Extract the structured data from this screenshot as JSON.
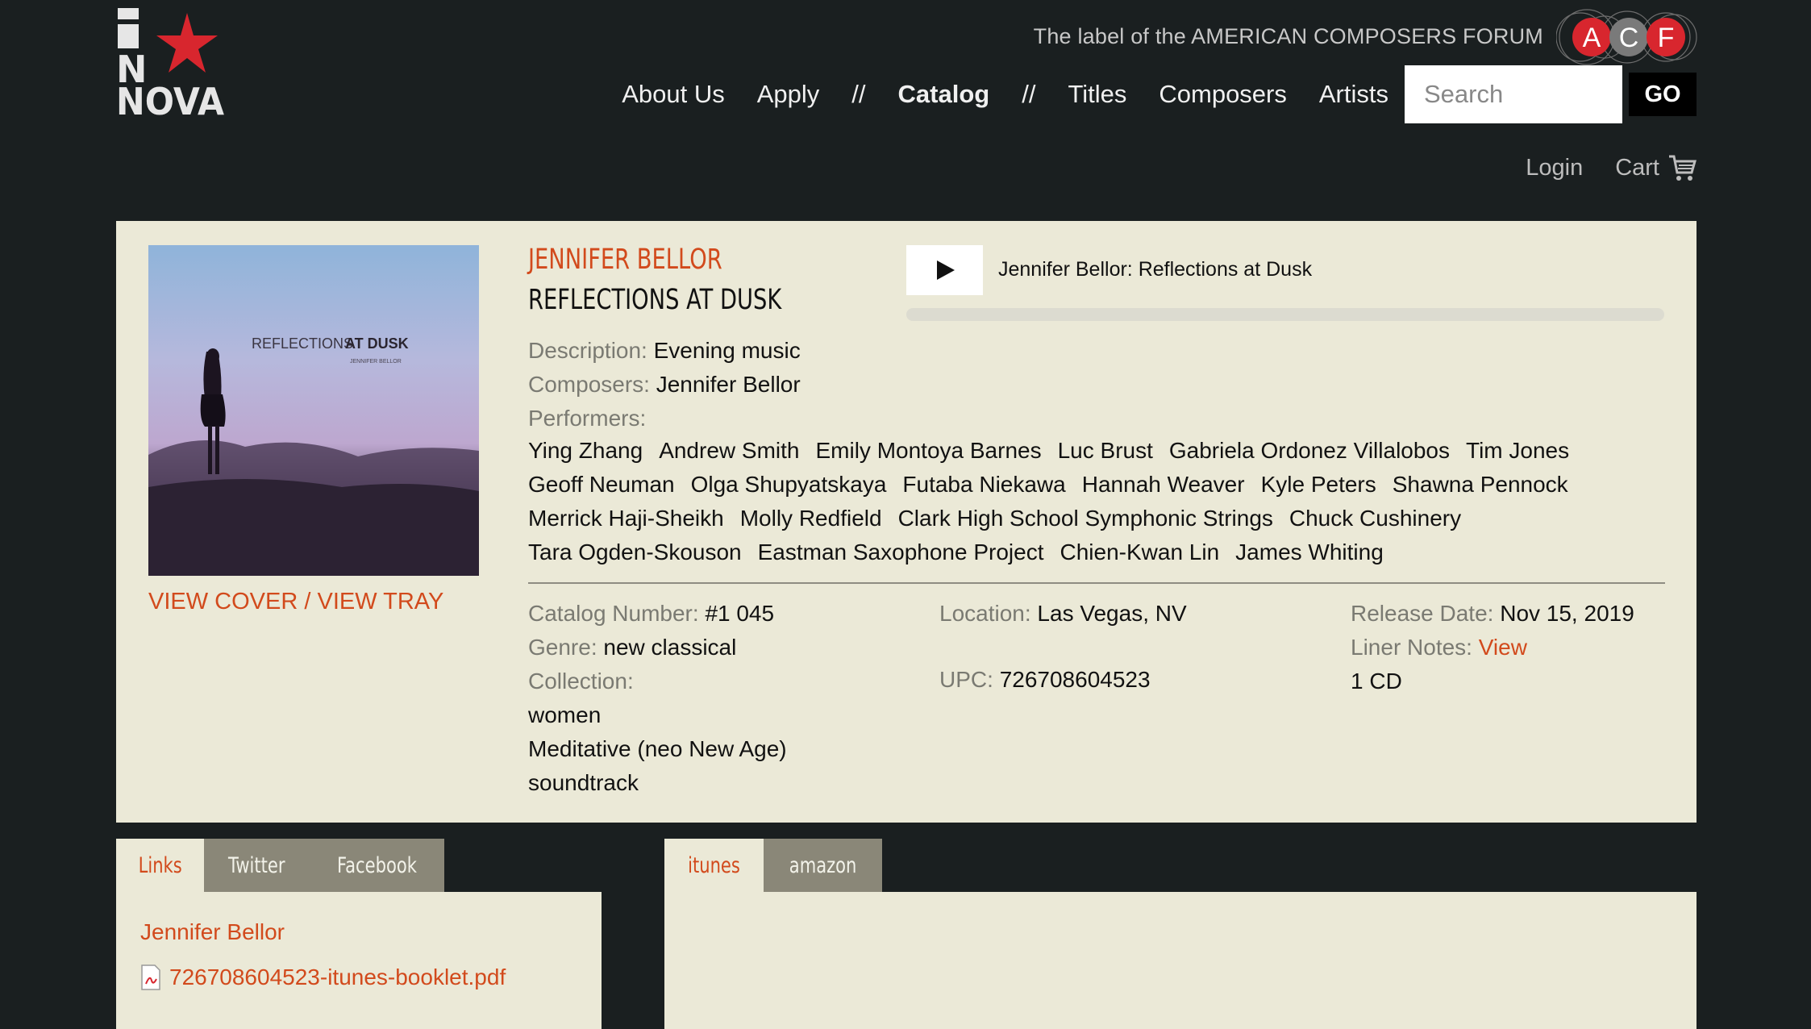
{
  "header": {
    "logo_text": "NOVA",
    "tagline": "The label of the AMERICAN COMPOSERS FORUM",
    "acf_letters": [
      "A",
      "C",
      "F"
    ],
    "nav": {
      "about": "About Us",
      "apply": "Apply",
      "sep1": "//",
      "catalog": "Catalog",
      "sep2": "//",
      "titles": "Titles",
      "composers": "Composers",
      "artists": "Artists"
    },
    "search": {
      "placeholder": "Search",
      "go_label": "GO"
    },
    "account": {
      "login": "Login",
      "cart": "Cart"
    }
  },
  "album": {
    "artist": "JENNIFER BELLOR",
    "title": "REFLECTIONS AT DUSK",
    "cover_link": "VIEW COVER / VIEW TRAY",
    "player": {
      "track_title": "Jennifer Bellor: Reflections at Dusk",
      "progress": 0
    },
    "description_label": "Description:",
    "description": "Evening music",
    "composers_label": "Composers:",
    "composers": "Jennifer Bellor",
    "performers_label": "Performers:",
    "performers": [
      "Ying Zhang",
      "Andrew Smith",
      "Emily Montoya Barnes",
      "Luc Brust",
      "Gabriela Ordonez Villalobos",
      "Tim Jones",
      "Geoff Neuman",
      "Olga Shupyatskaya",
      "Futaba Niekawa",
      "Hannah Weaver",
      "Kyle Peters",
      "Shawna Pennock",
      "Merrick Haji-Sheikh",
      "Molly Redfield",
      "Clark High School Symphonic Strings",
      "Chuck Cushinery",
      "Tara Ogden-Skouson",
      "Eastman Saxophone Project",
      "Chien-Kwan Lin",
      "James Whiting"
    ],
    "catalog_label": "Catalog Number:",
    "catalog_number": "#1 045",
    "genre_label": "Genre:",
    "genre": "new classical",
    "collection_label": "Collection:",
    "collections": [
      "women",
      "Meditative (neo New Age)",
      "soundtrack"
    ],
    "location_label": "Location:",
    "location": "Las Vegas, NV",
    "upc_label": "UPC:",
    "upc": "726708604523",
    "release_label": "Release Date:",
    "release_date": "Nov 15, 2019",
    "liner_label": "Liner Notes:",
    "liner_link": "View",
    "format": "1 CD",
    "cover_text_line1": "REFLECTIONS",
    "cover_text_line2": "AT DUSK",
    "cover_text_line3": "JENNIFER BELLOR"
  },
  "links_tabs": {
    "tabs": [
      "Links",
      "Twitter",
      "Facebook"
    ],
    "items": [
      "Jennifer Bellor",
      "726708604523-itunes-booklet.pdf"
    ]
  },
  "store_tabs": {
    "tabs": [
      "itunes",
      "amazon"
    ]
  },
  "colors": {
    "accent": "#d24a1c",
    "panel": "#ebe9d7",
    "background": "#1a1f20",
    "acf_red": "#d8262e"
  }
}
